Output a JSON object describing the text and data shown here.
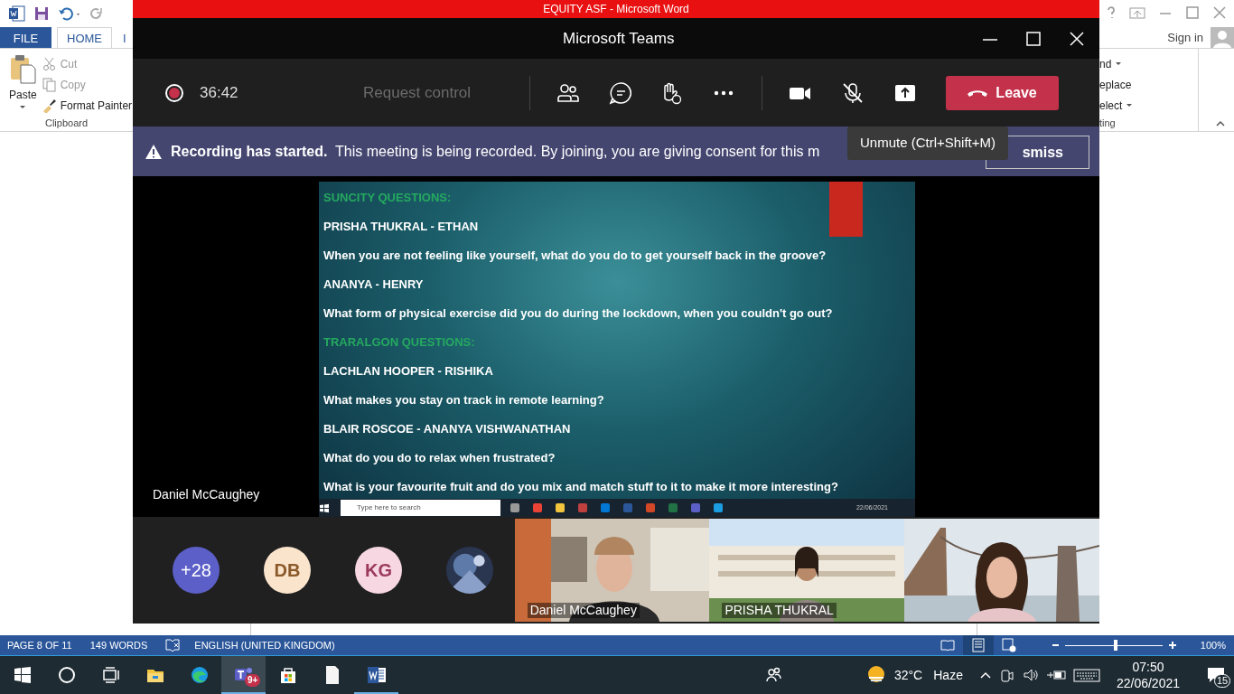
{
  "word": {
    "title": "EQUITY ASF  -  Microsoft Word",
    "tabs": [
      {
        "label": "FILE",
        "kind": "file",
        "selected": false
      },
      {
        "label": "HOME",
        "kind": "tab",
        "selected": true
      },
      {
        "label": "I",
        "kind": "tab",
        "selected": false
      }
    ],
    "sign_in": "Sign in",
    "clipboard": {
      "paste": "Paste",
      "label": "Clipboard",
      "items": [
        {
          "kind": "cut",
          "label": "Cut",
          "disabled": true
        },
        {
          "kind": "copy",
          "label": "Copy",
          "disabled": true
        },
        {
          "kind": "painter",
          "label": "Format Painter",
          "disabled": false
        }
      ]
    },
    "editing": {
      "label": "ting",
      "items": [
        {
          "label": "nd",
          "caret": true
        },
        {
          "label": "eplace",
          "caret": false
        },
        {
          "label": "elect",
          "caret": true
        }
      ]
    },
    "status_bar": {
      "page": "PAGE 8 OF 11",
      "words": "149 WORDS",
      "language": "ENGLISH (UNITED KINGDOM)",
      "views": [
        {
          "kind": "read",
          "selected": false
        },
        {
          "kind": "print",
          "selected": true
        },
        {
          "kind": "web",
          "selected": false
        }
      ],
      "zoom_slider": {
        "level": 0.52
      },
      "zoom": "100%"
    }
  },
  "teams": {
    "title": "Microsoft Teams",
    "timer": "36:42",
    "request_control": {
      "label": "Request control",
      "disabled": true
    },
    "mic_muted": true,
    "leave": "Leave",
    "banner": {
      "title": "Recording has started.",
      "text": "This meeting is being recorded. By joining, you are giving consent for this m",
      "button": "smiss"
    },
    "tooltip": "Unmute (Ctrl+Shift+M)",
    "presenter": "Daniel McCaughey",
    "shared_screen": {
      "lines": [
        {
          "kind": "heading",
          "text": "SUNCITY QUESTIONS:"
        },
        {
          "kind": "text",
          "text": "PRISHA THUKRAL - ETHAN"
        },
        {
          "kind": "text",
          "text": "When you are not feeling like yourself, what do you do to get yourself back in the groove?"
        },
        {
          "kind": "text",
          "text": "ANANYA - HENRY"
        },
        {
          "kind": "text",
          "text": "What form of physical exercise did you do during the lockdown, when you couldn't go out?"
        },
        {
          "kind": "heading",
          "text": "TRARALGON QUESTIONS:"
        },
        {
          "kind": "text",
          "text": "LACHLAN HOOPER -   RISHIKA"
        },
        {
          "kind": "text",
          "text": "What makes you stay on track in remote learning?"
        },
        {
          "kind": "text",
          "text": "BLAIR ROSCOE  -    ANANYA VISHWANATHAN"
        },
        {
          "kind": "text",
          "text": "What do you do to relax when frustrated?"
        },
        {
          "kind": "text",
          "text": "What is your favourite fruit and do you mix and match stuff to it to make it more interesting?"
        }
      ],
      "search_placeholder": "Type here to search",
      "date": "22/06/2021"
    },
    "avatars": [
      {
        "kind": "count",
        "text": "+28",
        "color": "#5b5fc7"
      },
      {
        "kind": "initials",
        "text": "DB",
        "color": "#fbe4cc"
      },
      {
        "kind": "initials",
        "text": "KG",
        "color": "#f7d7e2"
      },
      {
        "kind": "picture"
      }
    ],
    "videos": [
      {
        "name": "Daniel McCaughey",
        "kind": "office"
      },
      {
        "name": "PRISHA THUKRAL",
        "kind": "building"
      },
      {
        "kind": "bridge"
      }
    ]
  },
  "taskbar": {
    "apps": [
      {
        "kind": "explorer",
        "open": false,
        "selected": false
      },
      {
        "kind": "edge",
        "open": false,
        "selected": false
      },
      {
        "kind": "teams",
        "open": true,
        "selected": true,
        "badge": "9+"
      },
      {
        "kind": "store",
        "open": false,
        "selected": false
      },
      {
        "kind": "file",
        "open": false,
        "selected": false
      },
      {
        "kind": "word",
        "open": true,
        "selected": false
      }
    ],
    "temperature": "32°C",
    "weather": "Haze",
    "time": "07:50",
    "date": "22/06/2021",
    "notifications": "15"
  }
}
